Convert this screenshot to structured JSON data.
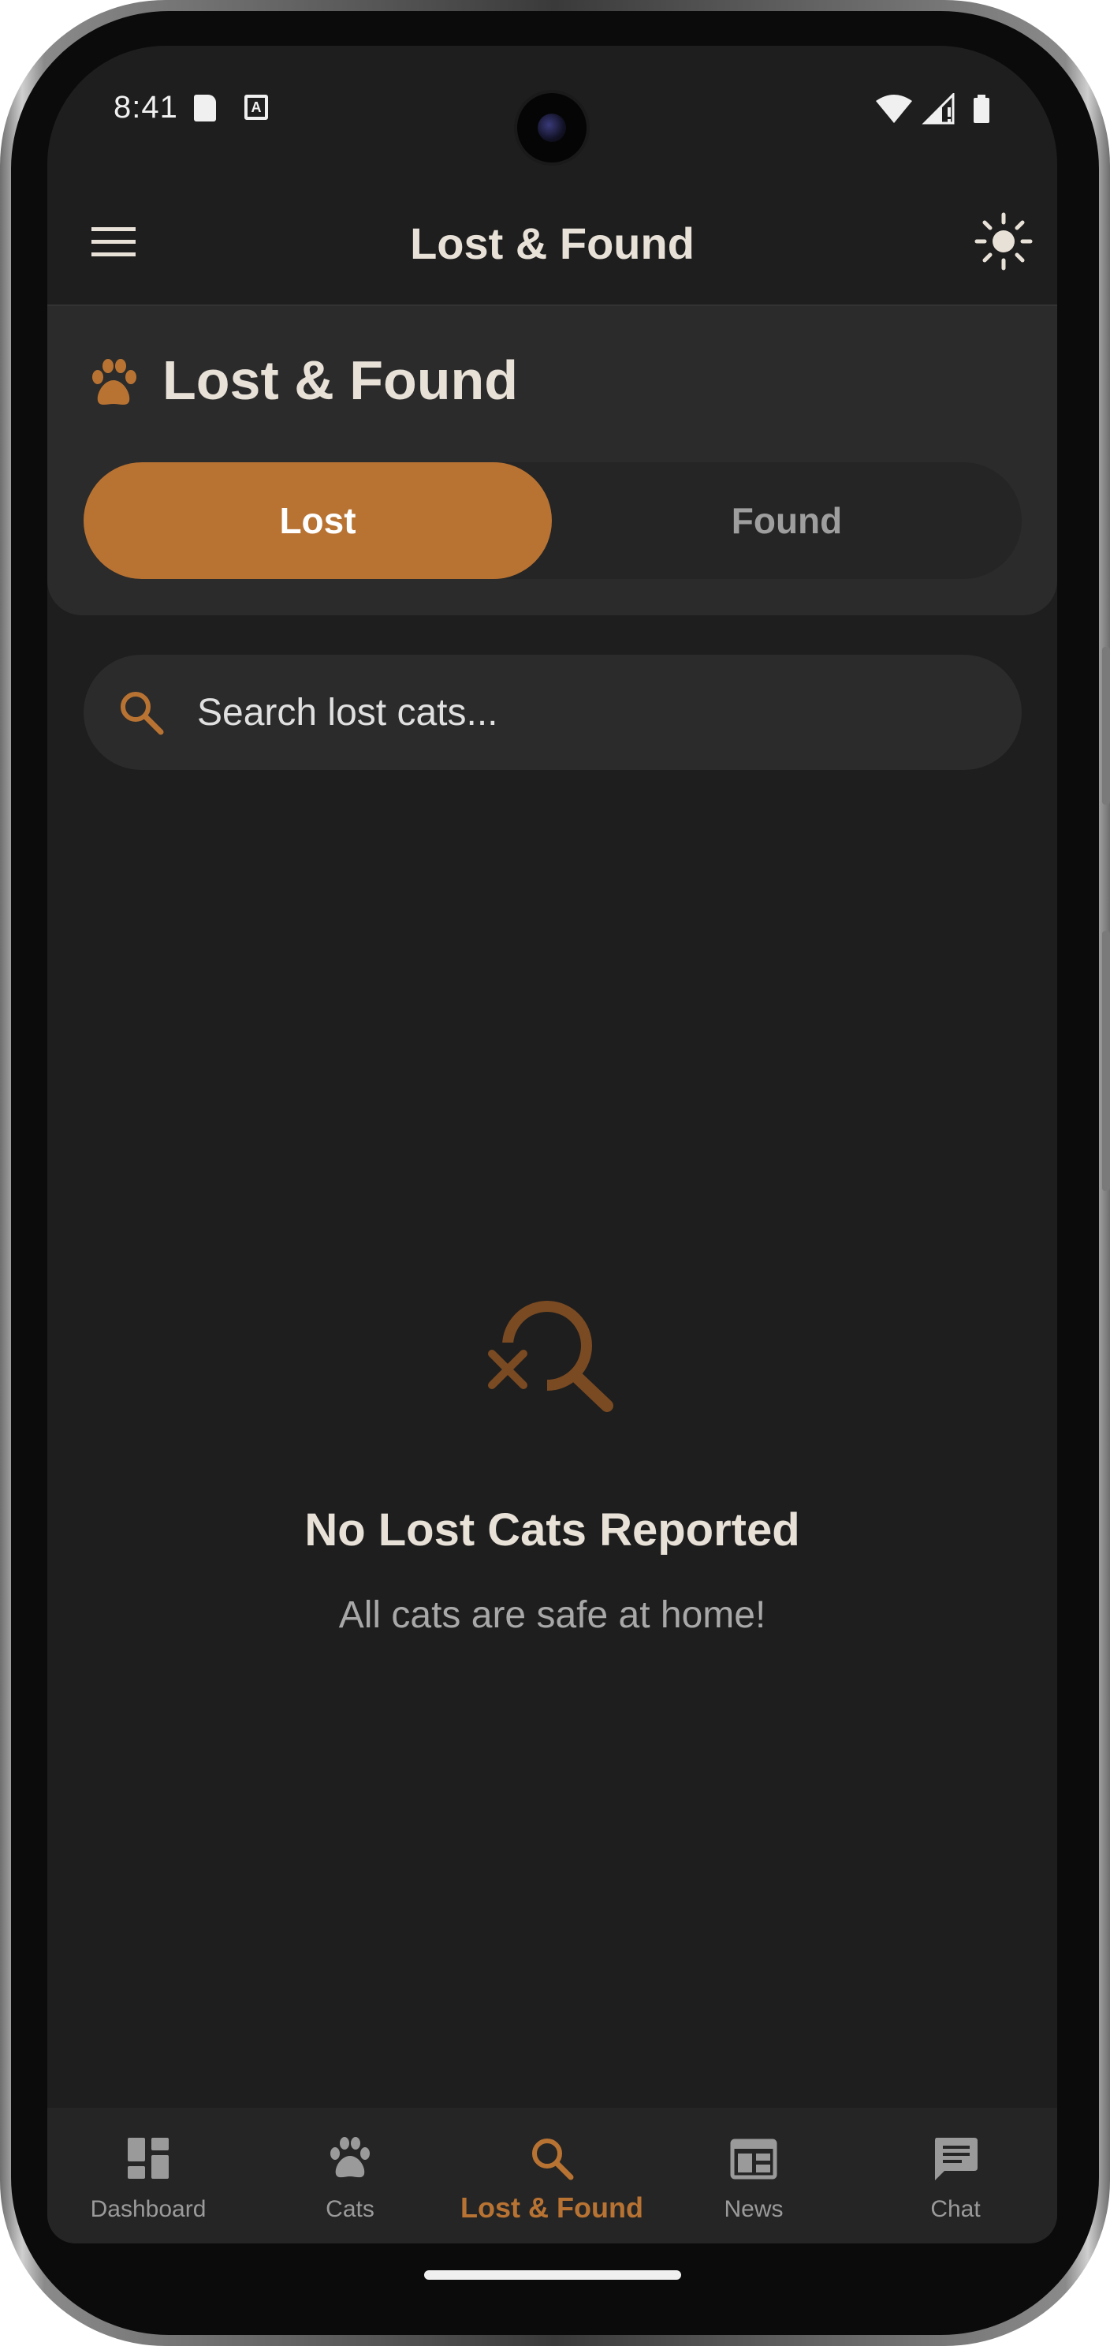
{
  "status_bar": {
    "time": "8:41"
  },
  "app_bar": {
    "title": "Lost & Found",
    "menu_icon": "hamburger-menu-icon",
    "theme_icon": "sun-icon"
  },
  "header": {
    "title": "Lost & Found",
    "icon": "paw-icon",
    "tabs": [
      {
        "label": "Lost",
        "selected": true
      },
      {
        "label": "Found",
        "selected": false
      }
    ]
  },
  "search": {
    "placeholder": "Search lost cats...",
    "value": ""
  },
  "empty_state": {
    "icon": "search-off-icon",
    "title": "No Lost Cats Reported",
    "subtitle": "All cats are safe at home!"
  },
  "bottom_nav": {
    "items": [
      {
        "label": "Dashboard",
        "icon": "dashboard-icon",
        "active": false
      },
      {
        "label": "Cats",
        "icon": "paw-icon",
        "active": false
      },
      {
        "label": "Lost & Found",
        "icon": "search-icon",
        "active": true
      },
      {
        "label": "News",
        "icon": "newspaper-icon",
        "active": false
      },
      {
        "label": "Chat",
        "icon": "chat-icon",
        "active": false
      }
    ]
  },
  "colors": {
    "accent": "#b87333",
    "background": "#1e1e1e",
    "surface": "#2b2b2b",
    "text_primary": "#e8e1d8",
    "text_secondary": "#9e9e9e"
  }
}
